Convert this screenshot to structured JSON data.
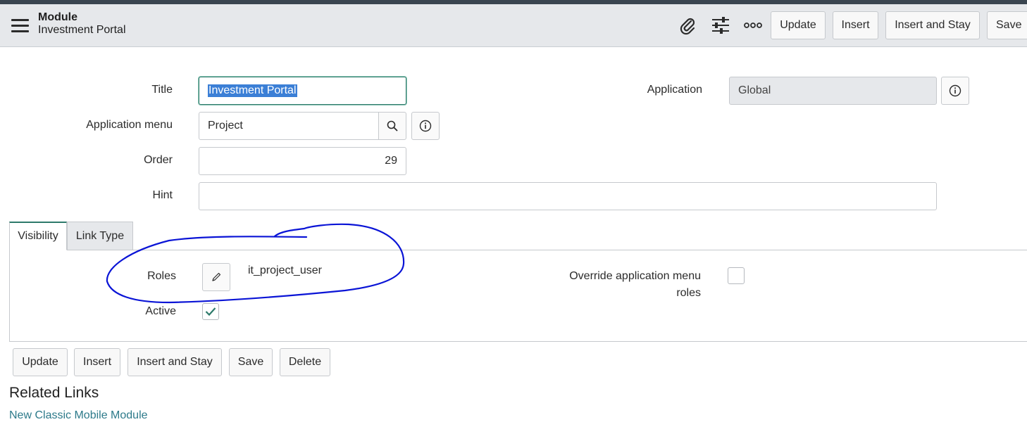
{
  "header": {
    "record_type": "Module",
    "record_title": "Investment Portal",
    "icons": [
      "menu-icon",
      "paperclip-icon",
      "sliders-icon",
      "more-icon"
    ],
    "buttons": {
      "update": "Update",
      "insert": "Insert",
      "insert_and_stay": "Insert and Stay",
      "save": "Save"
    }
  },
  "form": {
    "title": {
      "label": "Title",
      "value": "Investment Portal"
    },
    "application": {
      "label": "Application",
      "value": "Global"
    },
    "application_menu": {
      "label": "Application menu",
      "value": "Project"
    },
    "order": {
      "label": "Order",
      "value": "29"
    },
    "hint": {
      "label": "Hint",
      "value": ""
    }
  },
  "tabs": [
    {
      "label": "Visibility",
      "active": true
    },
    {
      "label": "Link Type",
      "active": false
    }
  ],
  "visibility": {
    "roles": {
      "label": "Roles",
      "value": "it_project_user"
    },
    "active": {
      "label": "Active",
      "checked": true
    },
    "override": {
      "label_line1": "Override application menu",
      "label_line2": "roles",
      "checked": false
    }
  },
  "footer_buttons": {
    "update": "Update",
    "insert": "Insert",
    "insert_and_stay": "Insert and Stay",
    "save": "Save",
    "delete": "Delete"
  },
  "related": {
    "heading": "Related Links",
    "link": "New Classic Mobile Module"
  },
  "colors": {
    "accent": "#2d7a6a",
    "annotation": "#0a14d6",
    "selection": "#3b7fd6"
  }
}
